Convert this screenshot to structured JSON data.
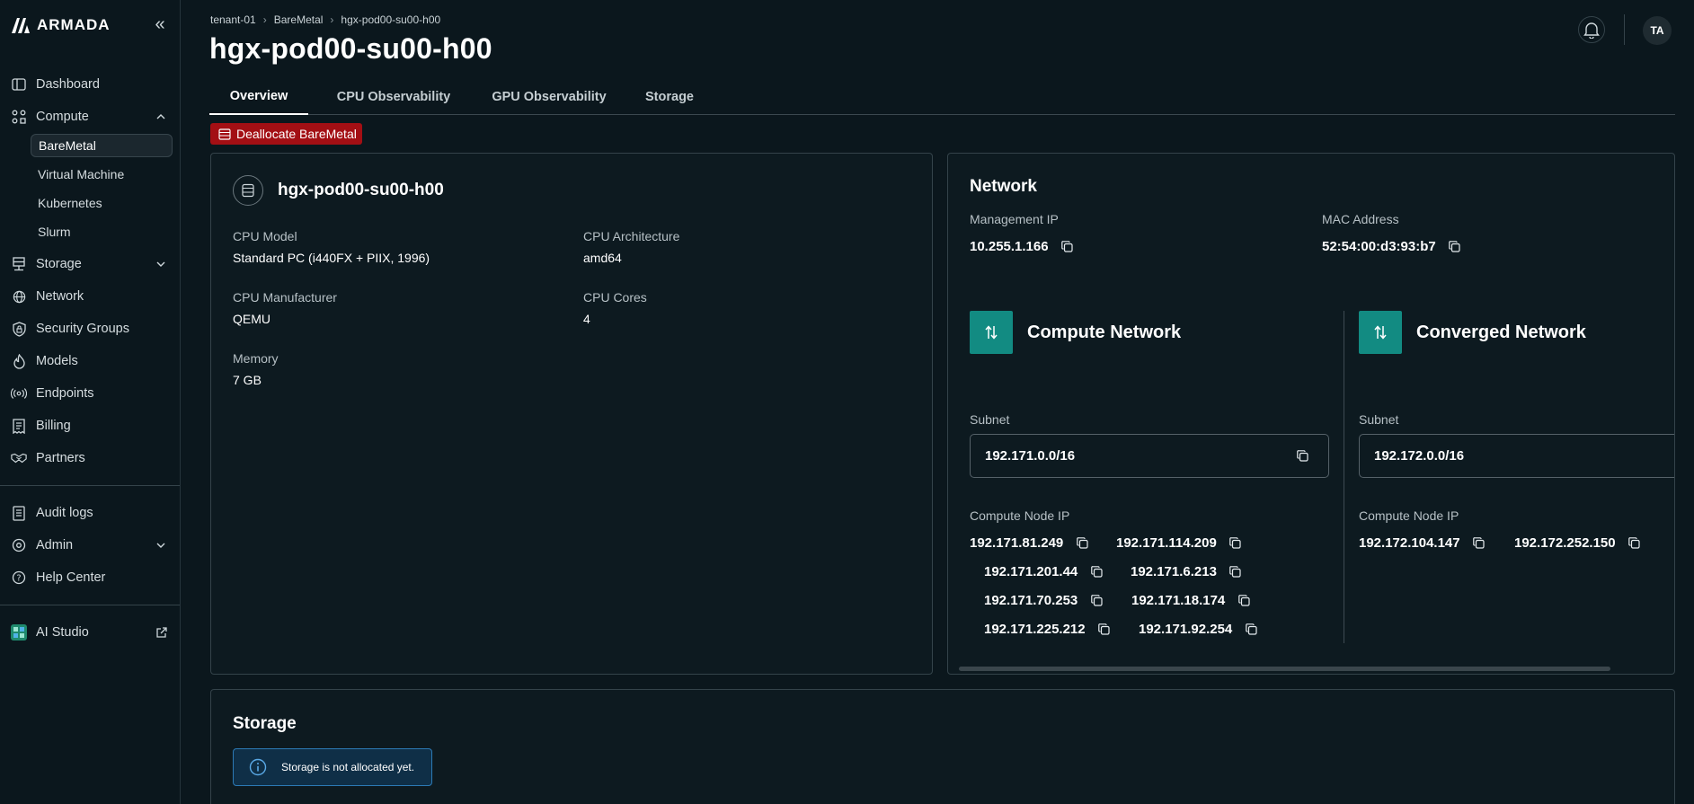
{
  "app": {
    "logo_text": "ARMADA"
  },
  "sidebar": {
    "items": [
      {
        "label": "Dashboard",
        "icon": "dashboard-icon"
      },
      {
        "label": "Compute",
        "icon": "compute-icon",
        "expanded": true
      },
      {
        "label": "Storage",
        "icon": "storage-icon"
      },
      {
        "label": "Network",
        "icon": "globe-icon"
      },
      {
        "label": "Security Groups",
        "icon": "shield-lock-icon"
      },
      {
        "label": "Models",
        "icon": "flame-icon"
      },
      {
        "label": "Endpoints",
        "icon": "broadcast-icon"
      },
      {
        "label": "Billing",
        "icon": "receipt-icon"
      },
      {
        "label": "Partners",
        "icon": "handshake-icon"
      },
      {
        "label": "Audit logs",
        "icon": "log-icon"
      },
      {
        "label": "Admin",
        "icon": "gear-icon"
      },
      {
        "label": "Help Center",
        "icon": "help-icon"
      },
      {
        "label": "AI Studio",
        "icon": "ai-studio-icon"
      }
    ],
    "compute_sub": [
      {
        "label": "BareMetal",
        "active": true
      },
      {
        "label": "Virtual Machine"
      },
      {
        "label": "Kubernetes"
      },
      {
        "label": "Slurm"
      }
    ]
  },
  "header": {
    "breadcrumb": [
      "tenant-01",
      "BareMetal",
      "hgx-pod00-su00-h00"
    ],
    "title": "hgx-pod00-su00-h00",
    "avatar_initials": "TA"
  },
  "tabs": [
    "Overview",
    "CPU Observability",
    "GPU Observability",
    "Storage"
  ],
  "actions": {
    "deallocate_label": "Deallocate BareMetal"
  },
  "node": {
    "name": "hgx-pod00-su00-h00",
    "cpu_model_label": "CPU Model",
    "cpu_model": "Standard PC (i440FX + PIIX, 1996)",
    "cpu_arch_label": "CPU Architecture",
    "cpu_arch": "amd64",
    "cpu_mfr_label": "CPU Manufacturer",
    "cpu_mfr": "QEMU",
    "cpu_cores_label": "CPU Cores",
    "cpu_cores": "4",
    "memory_label": "Memory",
    "memory": "7 GB"
  },
  "network": {
    "title": "Network",
    "mgmt_ip_label": "Management IP",
    "mgmt_ip": "10.255.1.166",
    "mac_label": "MAC Address",
    "mac": "52:54:00:d3:93:b7",
    "compute": {
      "title": "Compute Network",
      "subnet_label": "Subnet",
      "subnet": "192.171.0.0/16",
      "node_ip_label": "Compute Node IP",
      "ips": [
        "192.171.81.249",
        "192.171.114.209",
        "192.171.201.44",
        "192.171.6.213",
        "192.171.70.253",
        "192.171.18.174",
        "192.171.225.212",
        "192.171.92.254"
      ]
    },
    "converged": {
      "title": "Converged Network",
      "subnet_label": "Subnet",
      "subnet": "192.172.0.0/16",
      "node_ip_label": "Compute Node IP",
      "ips": [
        "192.172.104.147",
        "192.172.252.150"
      ]
    }
  },
  "storage": {
    "title": "Storage",
    "message": "Storage is not allocated yet."
  },
  "colors": {
    "background": "#0b171d",
    "accent_teal": "#128b82",
    "danger": "#a30f14",
    "info": "#2c7ab5"
  }
}
